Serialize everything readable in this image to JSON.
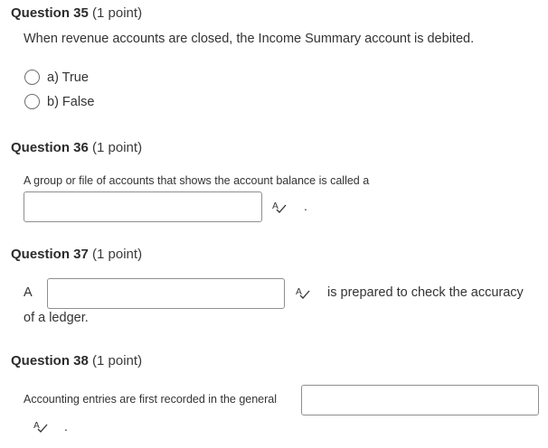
{
  "q35": {
    "number": "Question 35",
    "points": "(1 point)",
    "prompt": "When revenue accounts are closed, the Income Summary account is debited.",
    "options": [
      {
        "label": "a) True"
      },
      {
        "label": "b) False"
      }
    ]
  },
  "q36": {
    "number": "Question 36",
    "points": "(1 point)",
    "prompt": "A group or file of accounts that shows the account balance is called a",
    "answer_value": "",
    "after": "."
  },
  "q37": {
    "number": "Question 37",
    "points": "(1 point)",
    "before": "A",
    "answer_value": "",
    "after": "is prepared to check the accuracy",
    "continuation": "of a ledger."
  },
  "q38": {
    "number": "Question 38",
    "points": "(1 point)",
    "prompt": "Accounting entries are first recorded in the general",
    "answer_value": "",
    "after": "."
  },
  "icons": {
    "spellcheck": "spellcheck-icon",
    "radio": "radio-button-icon"
  }
}
